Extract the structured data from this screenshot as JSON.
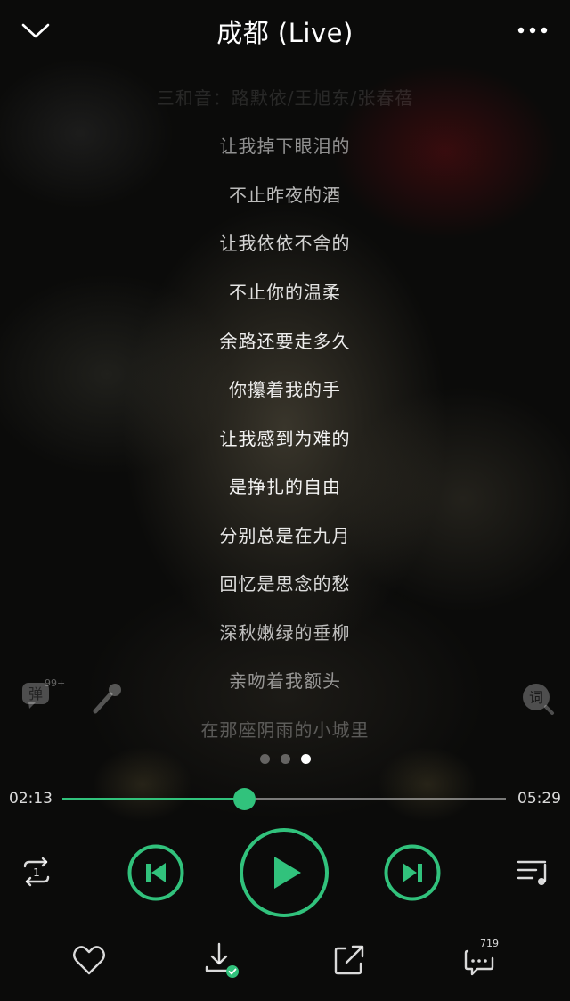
{
  "header": {
    "title": "成都 (Live)"
  },
  "lyrics": {
    "lines": [
      "三和音：路默依/王旭东/张春蓓",
      "让我掉下眼泪的",
      "不止昨夜的酒",
      "让我依依不舍的",
      "不止你的温柔",
      "余路还要走多久",
      "你攥着我的手",
      "让我感到为难的",
      "是挣扎的自由",
      "分别总是在九月",
      "回忆是思念的愁",
      "深秋嫩绿的垂柳",
      "亲吻着我额头",
      "在那座阴雨的小城里"
    ]
  },
  "side": {
    "danmu_label": "弹",
    "danmu_badge": "99+",
    "lyric_mode_label": "词"
  },
  "pager": {
    "count": 3,
    "active_index": 2
  },
  "progress": {
    "current": "02:13",
    "total": "05:29",
    "fraction": 0.41
  },
  "controls": {
    "loop_mode": "repeat-one",
    "state": "paused"
  },
  "bottom": {
    "comment_count": "719"
  },
  "colors": {
    "accent": "#31c27c",
    "background": "#0b0b0a"
  },
  "icons": [
    "chevron-down-icon",
    "more-icon",
    "danmu-icon",
    "microphone-icon",
    "lyric-icon",
    "repeat-one-icon",
    "previous-icon",
    "play-icon",
    "next-icon",
    "playlist-icon",
    "heart-icon",
    "download-icon",
    "share-icon",
    "comment-icon"
  ]
}
